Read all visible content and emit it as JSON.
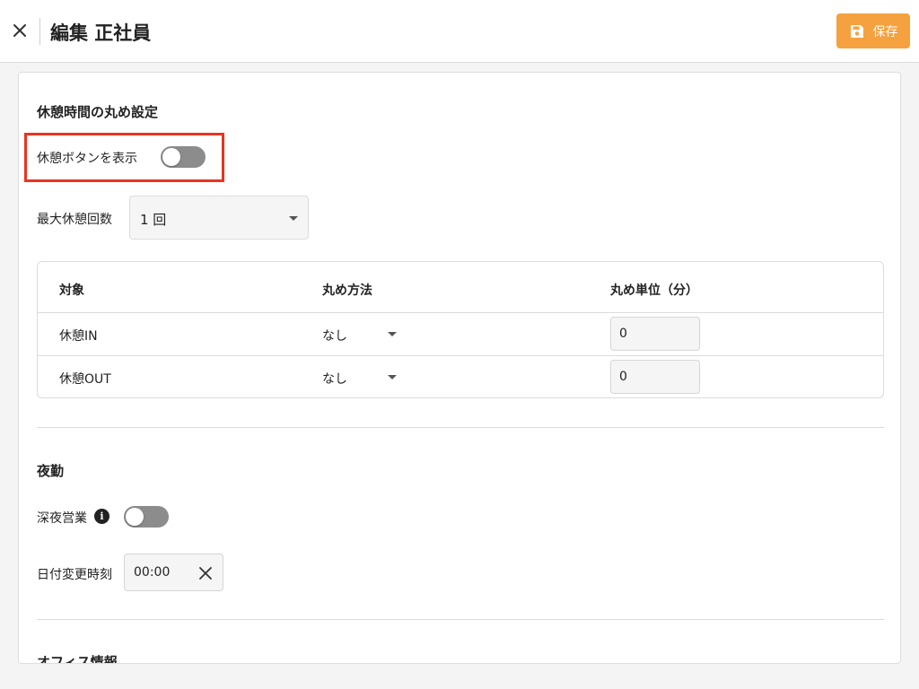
{
  "header": {
    "title": "編集 正社員",
    "save_label": "保存",
    "close_icon": "close-icon",
    "save_icon": "floppy-disk-icon",
    "accent_color": "#f5a13f"
  },
  "break_section": {
    "title": "休憩時間の丸め設定",
    "show_break_button_label": "休憩ボタンを表示",
    "show_break_button_on": false,
    "max_breaks_label": "最大休憩回数",
    "max_breaks_value": "1 回",
    "highlight_color": "#e8351f"
  },
  "rounding_table": {
    "headers": [
      "対象",
      "丸め方法",
      "丸め単位（分）"
    ],
    "rows": [
      {
        "target": "休憩IN",
        "method": "なし",
        "unit": "0"
      },
      {
        "target": "休憩OUT",
        "method": "なし",
        "unit": "0"
      }
    ]
  },
  "night_section": {
    "title": "夜勤",
    "late_night_label": "深夜営業",
    "late_night_on": false,
    "info_icon": "info-icon",
    "date_change_label": "日付変更時刻",
    "date_change_value": "00:00"
  },
  "office_section": {
    "title": "オフィス情報"
  }
}
